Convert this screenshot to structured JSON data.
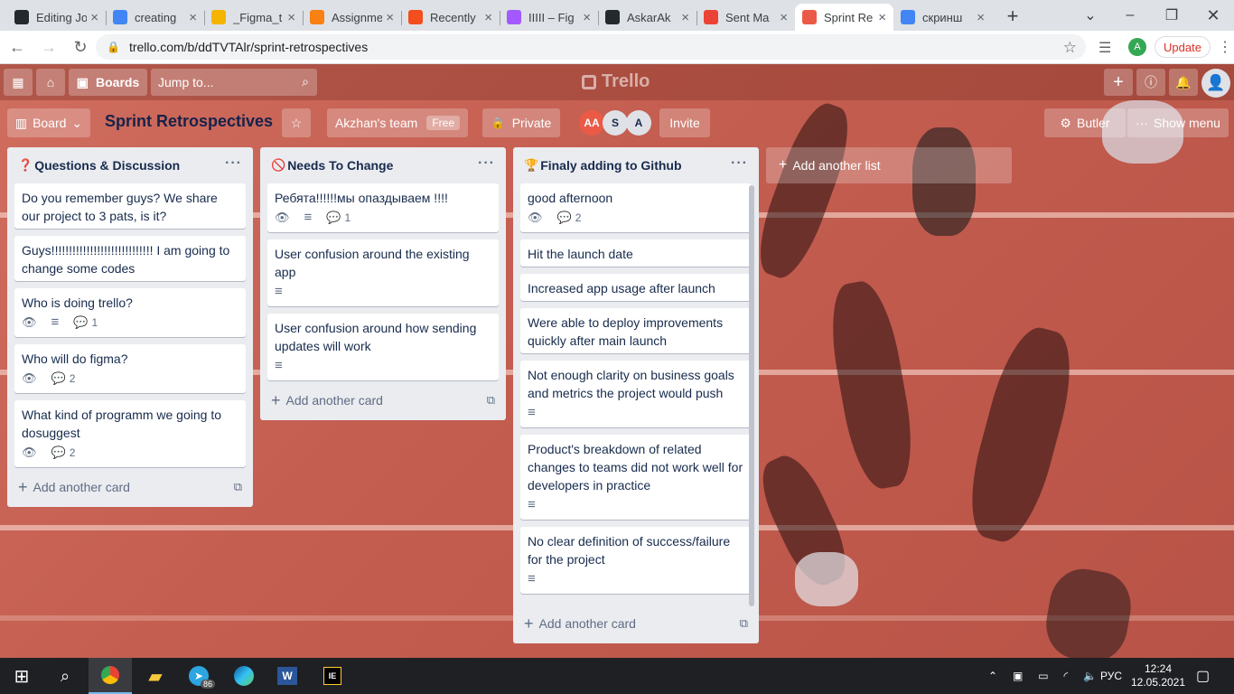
{
  "browser": {
    "tabs": [
      {
        "title": "Editing Jo",
        "favicon": "github-icon",
        "color": "#24292e",
        "active": false
      },
      {
        "title": "creating",
        "favicon": "google-icon",
        "color": "#4285f4",
        "active": false
      },
      {
        "title": "_Figma_t",
        "favicon": "drive-icon",
        "color": "#f4b400",
        "active": false
      },
      {
        "title": "Assignme",
        "favicon": "moodle-icon",
        "color": "#f98012",
        "active": false
      },
      {
        "title": "Recently",
        "favicon": "figma-icon",
        "color": "#f24e1e",
        "active": false
      },
      {
        "title": "IIIII – Fig",
        "favicon": "figma-icon",
        "color": "#a259ff",
        "active": false
      },
      {
        "title": "AskarAk",
        "favicon": "github-icon",
        "color": "#24292e",
        "active": false
      },
      {
        "title": "Sent Ma",
        "favicon": "gmail-icon",
        "color": "#ea4335",
        "active": false
      },
      {
        "title": "Sprint Re",
        "favicon": "trello-icon",
        "color": "#eb5a46",
        "active": true
      },
      {
        "title": "скринш",
        "favicon": "google-icon",
        "color": "#4285f4",
        "active": false
      }
    ],
    "url": "trello.com/b/ddTVTAlr/sprint-retrospectives",
    "profile_initial": "A",
    "update_label": "Update"
  },
  "trello": {
    "boards_label": "Boards",
    "jump_placeholder": "Jump to...",
    "logo": "Trello"
  },
  "board": {
    "view_label": "Board",
    "title": "Sprint Retrospectives",
    "team": "Akzhan's team",
    "team_badge": "Free",
    "visibility": "Private",
    "members": [
      {
        "initials": "AA",
        "bg": "#eb5a46",
        "fg": "#ffffff"
      },
      {
        "initials": "S",
        "bg": "#dfe1e6",
        "fg": "#172b4d"
      },
      {
        "initials": "A",
        "bg": "#dfe1e6",
        "fg": "#172b4d"
      }
    ],
    "invite_label": "Invite",
    "butler_label": "Butler",
    "show_menu_label": "Show menu",
    "add_list_label": "Add another list"
  },
  "lists": [
    {
      "title": "Questions & Discussion",
      "emoji": "❓",
      "cards": [
        {
          "text": "Do you remember guys? We share our project to 3 pats, is it?",
          "watch": false,
          "desc": false,
          "comments": ""
        },
        {
          "text": "Guys!!!!!!!!!!!!!!!!!!!!!!!!!!!!! I am going to change some codes",
          "watch": false,
          "desc": false,
          "comments": ""
        },
        {
          "text": "Who is doing trello?",
          "watch": true,
          "desc": true,
          "comments": "1"
        },
        {
          "text": "Who will do figma?",
          "watch": true,
          "desc": false,
          "comments": "2"
        },
        {
          "text": "What kind of programm we going to dosuggest",
          "watch": true,
          "desc": false,
          "comments": "2"
        }
      ],
      "add_label": "Add another card"
    },
    {
      "title": "Needs To Change",
      "emoji": "🚫",
      "cards": [
        {
          "text": "Ребята!!!!!!мы опаздываем !!!!",
          "watch": true,
          "desc": true,
          "comments": "1"
        },
        {
          "text": "User confusion around the existing app",
          "watch": false,
          "desc": true,
          "comments": ""
        },
        {
          "text": "User confusion around how sending updates will work",
          "watch": false,
          "desc": true,
          "comments": ""
        }
      ],
      "add_label": "Add another card"
    },
    {
      "title": "Finaly adding to Github",
      "emoji": "🏆",
      "cards": [
        {
          "text": "good afternoon",
          "watch": true,
          "desc": false,
          "comments": "2"
        },
        {
          "text": "Hit the launch date",
          "watch": false,
          "desc": false,
          "comments": ""
        },
        {
          "text": "Increased app usage after launch",
          "watch": false,
          "desc": false,
          "comments": ""
        },
        {
          "text": "Were able to deploy improvements quickly after main launch",
          "watch": false,
          "desc": false,
          "comments": ""
        },
        {
          "text": "Not enough clarity on business goals and metrics the project would push",
          "watch": false,
          "desc": true,
          "comments": ""
        },
        {
          "text": "Product's breakdown of related changes to teams did not work well for developers in practice",
          "watch": false,
          "desc": true,
          "comments": ""
        },
        {
          "text": "No clear definition of success/failure for the project",
          "watch": false,
          "desc": true,
          "comments": ""
        }
      ],
      "add_label": "Add another card"
    }
  ],
  "taskbar": {
    "lang": "РУС",
    "time": "12:24",
    "date": "12.05.2021",
    "telegram_badge": "86"
  }
}
